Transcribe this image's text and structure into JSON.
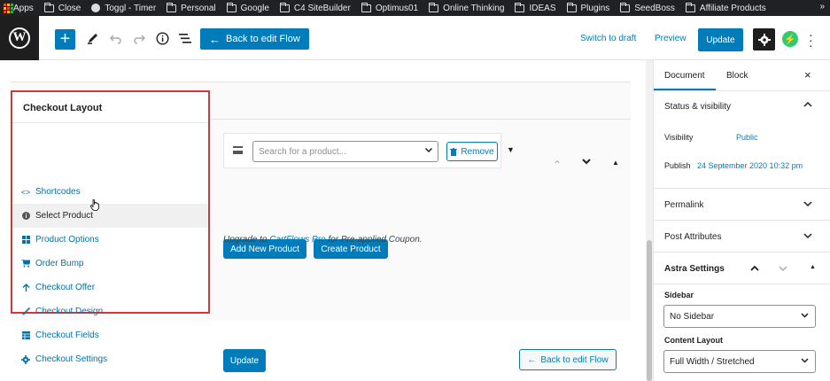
{
  "bookmarks": [
    {
      "icon": "apps-icon",
      "label": "Apps"
    },
    {
      "icon": "folder-icon",
      "label": "Close"
    },
    {
      "icon": "toggl-icon",
      "label": "Toggl - Timer"
    },
    {
      "icon": "folder-icon",
      "label": "Personal"
    },
    {
      "icon": "folder-icon",
      "label": "Google"
    },
    {
      "icon": "folder-icon",
      "label": "C4 SiteBuilder"
    },
    {
      "icon": "folder-icon",
      "label": "Optimus01"
    },
    {
      "icon": "folder-icon",
      "label": "Online Thinking"
    },
    {
      "icon": "folder-icon",
      "label": "IDEAS"
    },
    {
      "icon": "folder-icon",
      "label": "Plugins"
    },
    {
      "icon": "folder-icon",
      "label": "SeedBoss"
    },
    {
      "icon": "folder-icon",
      "label": "Affiliate Products"
    }
  ],
  "bookmarks_more": "»",
  "toolbar": {
    "logo": "W",
    "add": "+",
    "back_label": "Back to edit Flow",
    "switch_draft": "Switch to draft",
    "preview": "Preview",
    "update": "Update"
  },
  "checkout_layout": {
    "title": "Checkout Layout",
    "items": [
      {
        "label": "Shortcodes",
        "icon": "code-icon"
      },
      {
        "label": "Select Product",
        "icon": "info-icon"
      },
      {
        "label": "Product Options",
        "icon": "grid-icon"
      },
      {
        "label": "Order Bump",
        "icon": "cart-icon"
      },
      {
        "label": "Checkout Offer",
        "icon": "arrow-up-icon"
      },
      {
        "label": "Checkout Design",
        "icon": "brush-icon"
      },
      {
        "label": "Checkout Fields",
        "icon": "table-icon"
      },
      {
        "label": "Checkout Settings",
        "icon": "gear-icon"
      }
    ]
  },
  "product": {
    "search_placeholder": "Search for a product...",
    "remove": "Remove",
    "add_new": "Add New Product",
    "create": "Create Product",
    "upgrade_prefix": "Upgrade to ",
    "upgrade_link": "CartFlows Pro",
    "upgrade_suffix": " for Pre-applied Coupon.",
    "update": "Update",
    "back_to_flow": "Back to edit Flow"
  },
  "sidebar": {
    "tab_document": "Document",
    "tab_block": "Block",
    "close": "×",
    "status_visibility": "Status & visibility",
    "visibility_label": "Visibility",
    "visibility_value": "Public",
    "publish_label": "Publish",
    "publish_value": "24 September 2020 10:32 pm",
    "permalink": "Permalink",
    "post_attributes": "Post Attributes",
    "astra_settings": "Astra Settings",
    "sidebar_label": "Sidebar",
    "sidebar_value": "No Sidebar",
    "content_layout_label": "Content Layout",
    "content_layout_value": "Full Width / Stretched"
  }
}
